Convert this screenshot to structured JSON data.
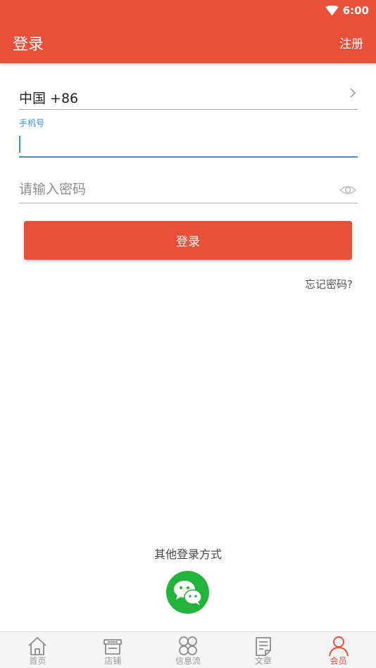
{
  "status_bar": {
    "time": "6:00",
    "wifi_icon": "wifi-icon"
  },
  "header": {
    "title": "登录",
    "register_label": "注册"
  },
  "form": {
    "country_code": "中国 +86",
    "phone_label": "手机号",
    "phone_value": "",
    "password_placeholder": "请输入密码",
    "login_label": "登录",
    "forgot_label": "忘记密码?"
  },
  "social": {
    "title": "其他登录方式",
    "wechat_icon": "wechat-icon"
  },
  "bottom_nav": [
    {
      "label": "首页",
      "icon": "home-icon",
      "active": false
    },
    {
      "label": "店铺",
      "icon": "shop-icon",
      "active": false
    },
    {
      "label": "信息流",
      "icon": "feed-icon",
      "active": false
    },
    {
      "label": "文章",
      "icon": "article-icon",
      "active": false
    },
    {
      "label": "会员",
      "icon": "member-icon",
      "active": true
    }
  ],
  "colors": {
    "primary": "#e8503a",
    "focus": "#3d8fd9",
    "wechat": "#22b33a",
    "nav_inactive": "#999999"
  }
}
